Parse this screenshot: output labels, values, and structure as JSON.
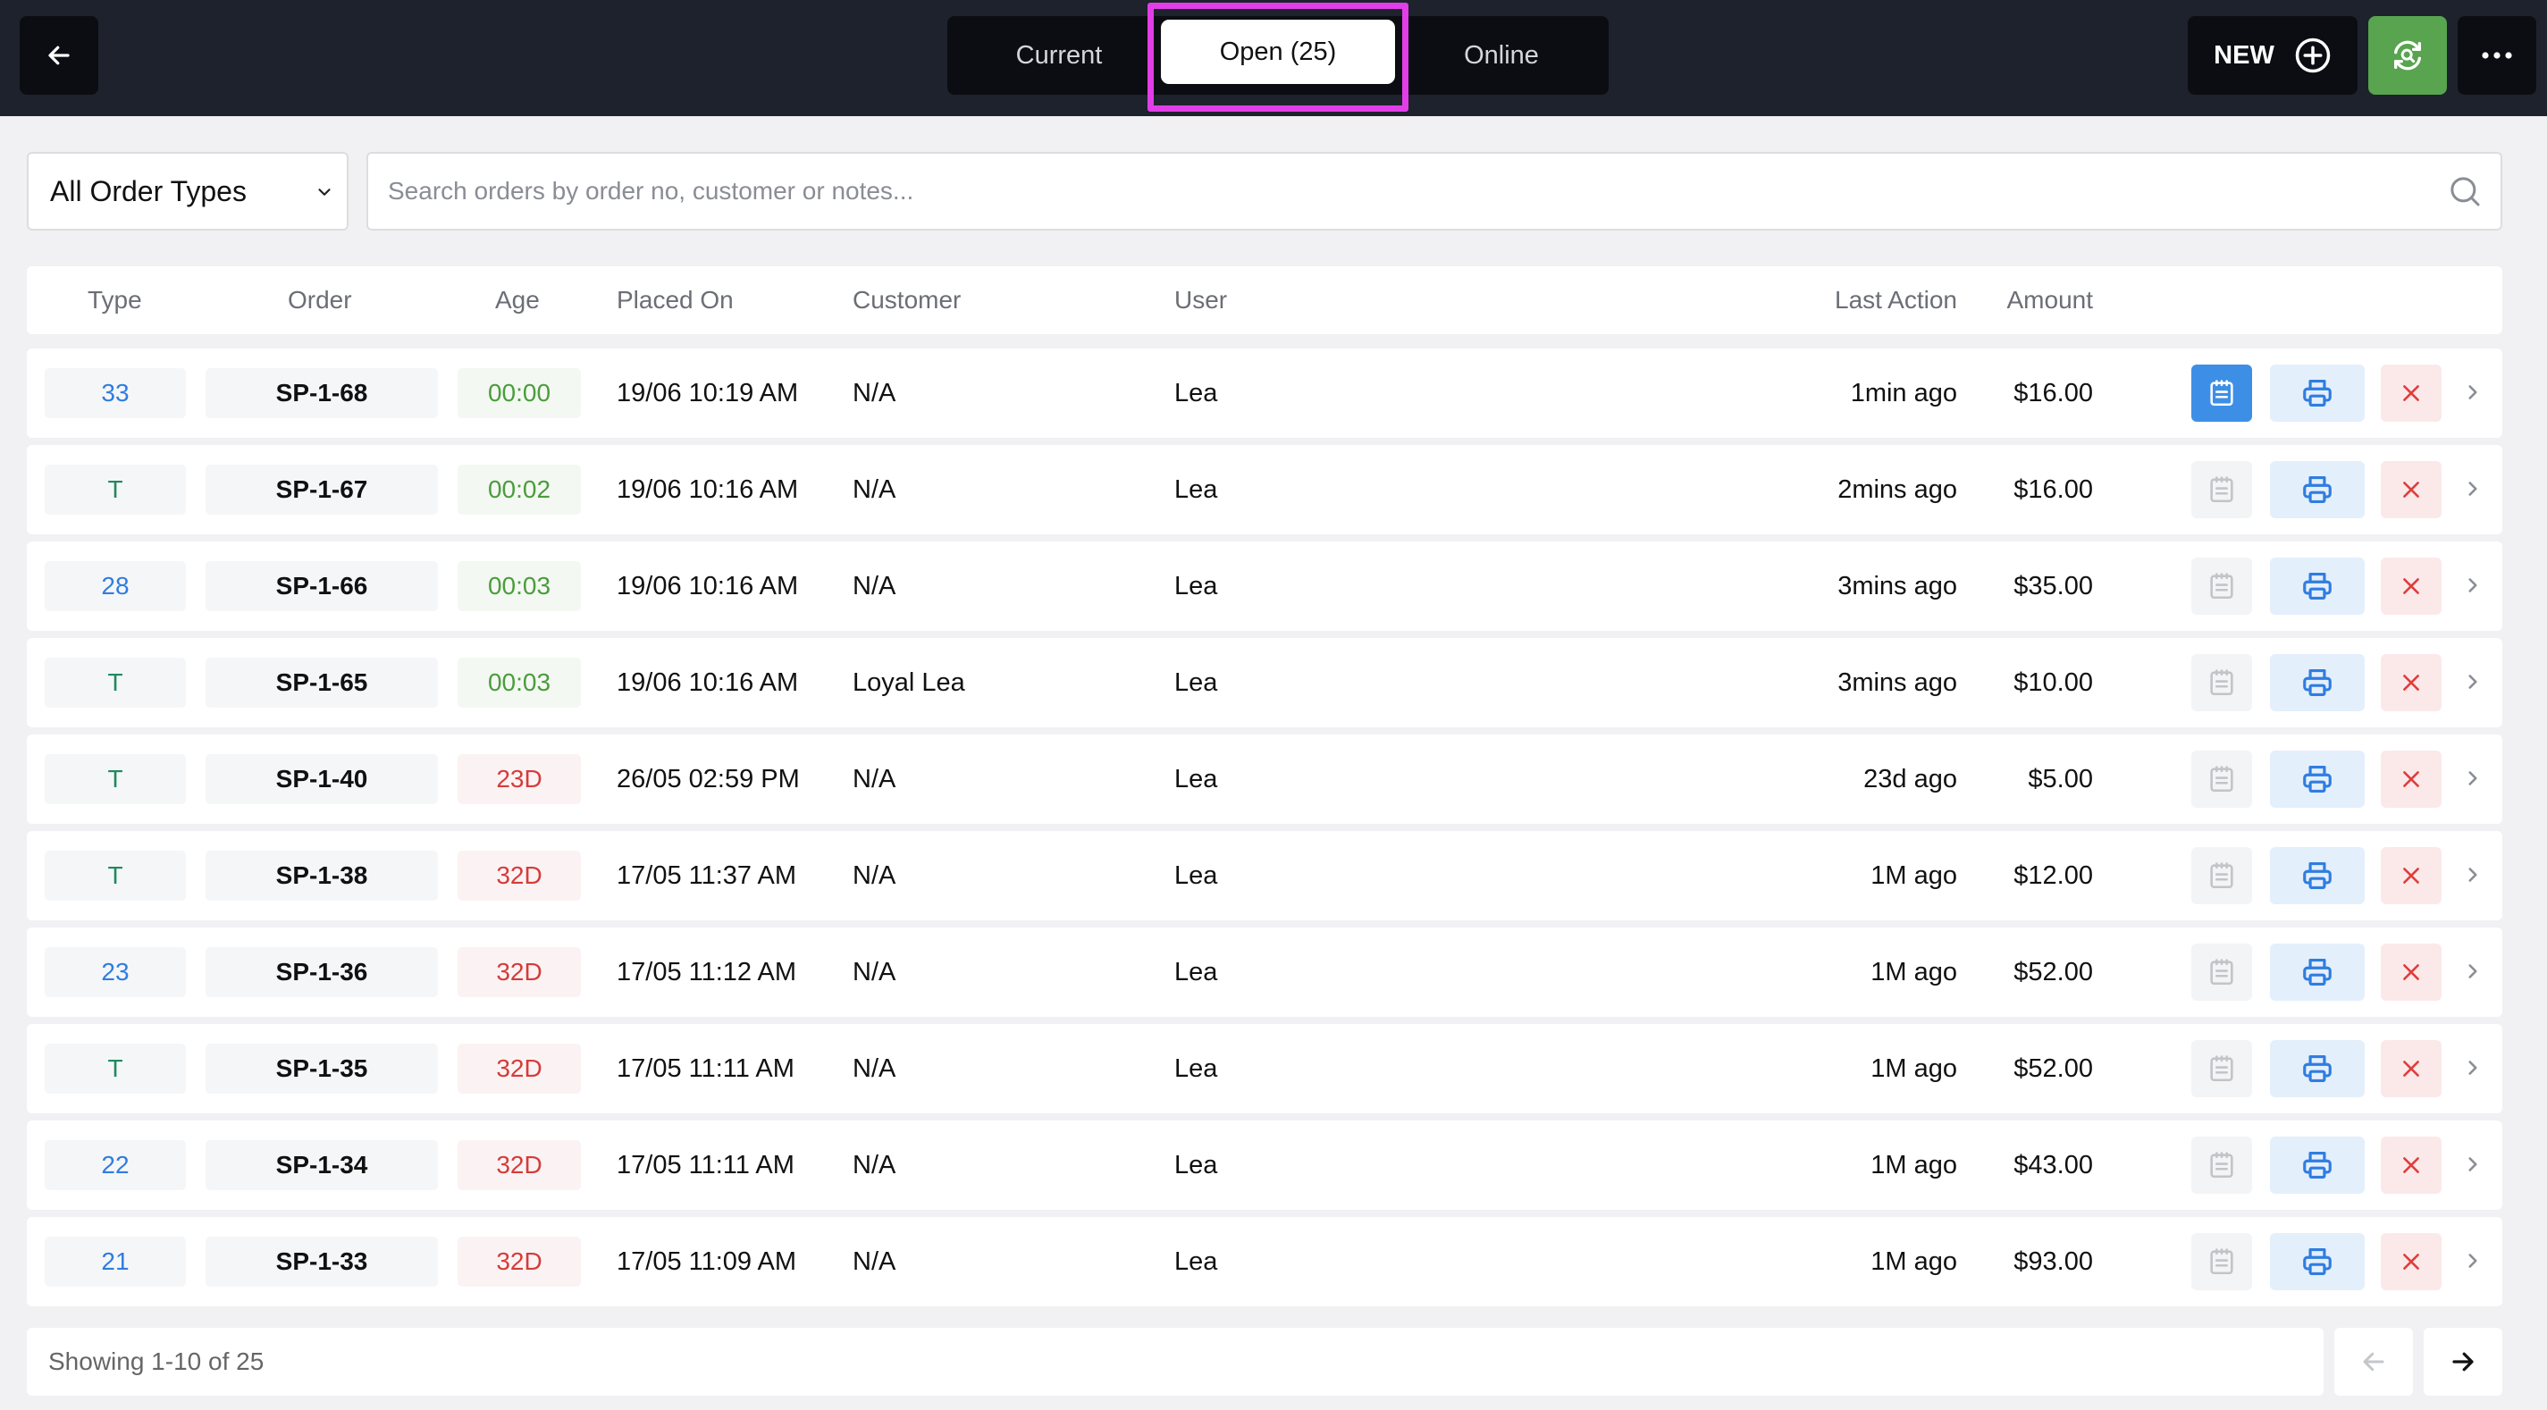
{
  "header": {
    "tabs": [
      {
        "label": "Current",
        "active": false
      },
      {
        "label": "Open (25)",
        "active": true
      },
      {
        "label": "Online",
        "active": false
      }
    ],
    "new_label": "NEW",
    "icons": {
      "back": "arrow-left-icon",
      "new": "plus-circle-icon",
      "sync": "refresh-search-icon",
      "more": "more-horizontal-icon"
    },
    "colors": {
      "bar": "#1d222d",
      "sync": "#58a44f",
      "highlight": "#e23ee8"
    }
  },
  "filters": {
    "order_type": "All Order Types",
    "search_placeholder": "Search orders by order no, customer or notes...",
    "search_value": ""
  },
  "table": {
    "columns": [
      "Type",
      "Order",
      "Age",
      "Placed On",
      "Customer",
      "User",
      "Last Action",
      "Amount"
    ],
    "rows": [
      {
        "type": "33",
        "type_color": "blue",
        "order": "SP-1-68",
        "age": "00:00",
        "age_color": "green",
        "placed": "19/06 10:19 AM",
        "customer": "N/A",
        "user": "Lea",
        "last": "1min ago",
        "amount": "$16.00",
        "note_active": true
      },
      {
        "type": "T",
        "type_color": "green",
        "order": "SP-1-67",
        "age": "00:02",
        "age_color": "green",
        "placed": "19/06 10:16 AM",
        "customer": "N/A",
        "user": "Lea",
        "last": "2mins ago",
        "amount": "$16.00",
        "note_active": false
      },
      {
        "type": "28",
        "type_color": "blue",
        "order": "SP-1-66",
        "age": "00:03",
        "age_color": "green",
        "placed": "19/06 10:16 AM",
        "customer": "N/A",
        "user": "Lea",
        "last": "3mins ago",
        "amount": "$35.00",
        "note_active": false
      },
      {
        "type": "T",
        "type_color": "green",
        "order": "SP-1-65",
        "age": "00:03",
        "age_color": "green",
        "placed": "19/06 10:16 AM",
        "customer": "Loyal Lea",
        "user": "Lea",
        "last": "3mins ago",
        "amount": "$10.00",
        "note_active": false
      },
      {
        "type": "T",
        "type_color": "green",
        "order": "SP-1-40",
        "age": "23D",
        "age_color": "red",
        "placed": "26/05 02:59 PM",
        "customer": "N/A",
        "user": "Lea",
        "last": "23d ago",
        "amount": "$5.00",
        "note_active": false
      },
      {
        "type": "T",
        "type_color": "green",
        "order": "SP-1-38",
        "age": "32D",
        "age_color": "red",
        "placed": "17/05 11:37 AM",
        "customer": "N/A",
        "user": "Lea",
        "last": "1M ago",
        "amount": "$12.00",
        "note_active": false
      },
      {
        "type": "23",
        "type_color": "blue",
        "order": "SP-1-36",
        "age": "32D",
        "age_color": "red",
        "placed": "17/05 11:12 AM",
        "customer": "N/A",
        "user": "Lea",
        "last": "1M ago",
        "amount": "$52.00",
        "note_active": false
      },
      {
        "type": "T",
        "type_color": "green",
        "order": "SP-1-35",
        "age": "32D",
        "age_color": "red",
        "placed": "17/05 11:11 AM",
        "customer": "N/A",
        "user": "Lea",
        "last": "1M ago",
        "amount": "$52.00",
        "note_active": false
      },
      {
        "type": "22",
        "type_color": "blue",
        "order": "SP-1-34",
        "age": "32D",
        "age_color": "red",
        "placed": "17/05 11:11 AM",
        "customer": "N/A",
        "user": "Lea",
        "last": "1M ago",
        "amount": "$43.00",
        "note_active": false
      },
      {
        "type": "21",
        "type_color": "blue",
        "order": "SP-1-33",
        "age": "32D",
        "age_color": "red",
        "placed": "17/05 11:09 AM",
        "customer": "N/A",
        "user": "Lea",
        "last": "1M ago",
        "amount": "$93.00",
        "note_active": false
      }
    ],
    "row_icons": {
      "note": "notepad-icon",
      "print": "printer-icon",
      "cancel": "close-icon",
      "open": "chevron-right-icon"
    }
  },
  "footer": {
    "showing": "Showing 1-10 of 25",
    "icons": {
      "prev": "arrow-left-icon",
      "next": "arrow-right-icon"
    }
  }
}
